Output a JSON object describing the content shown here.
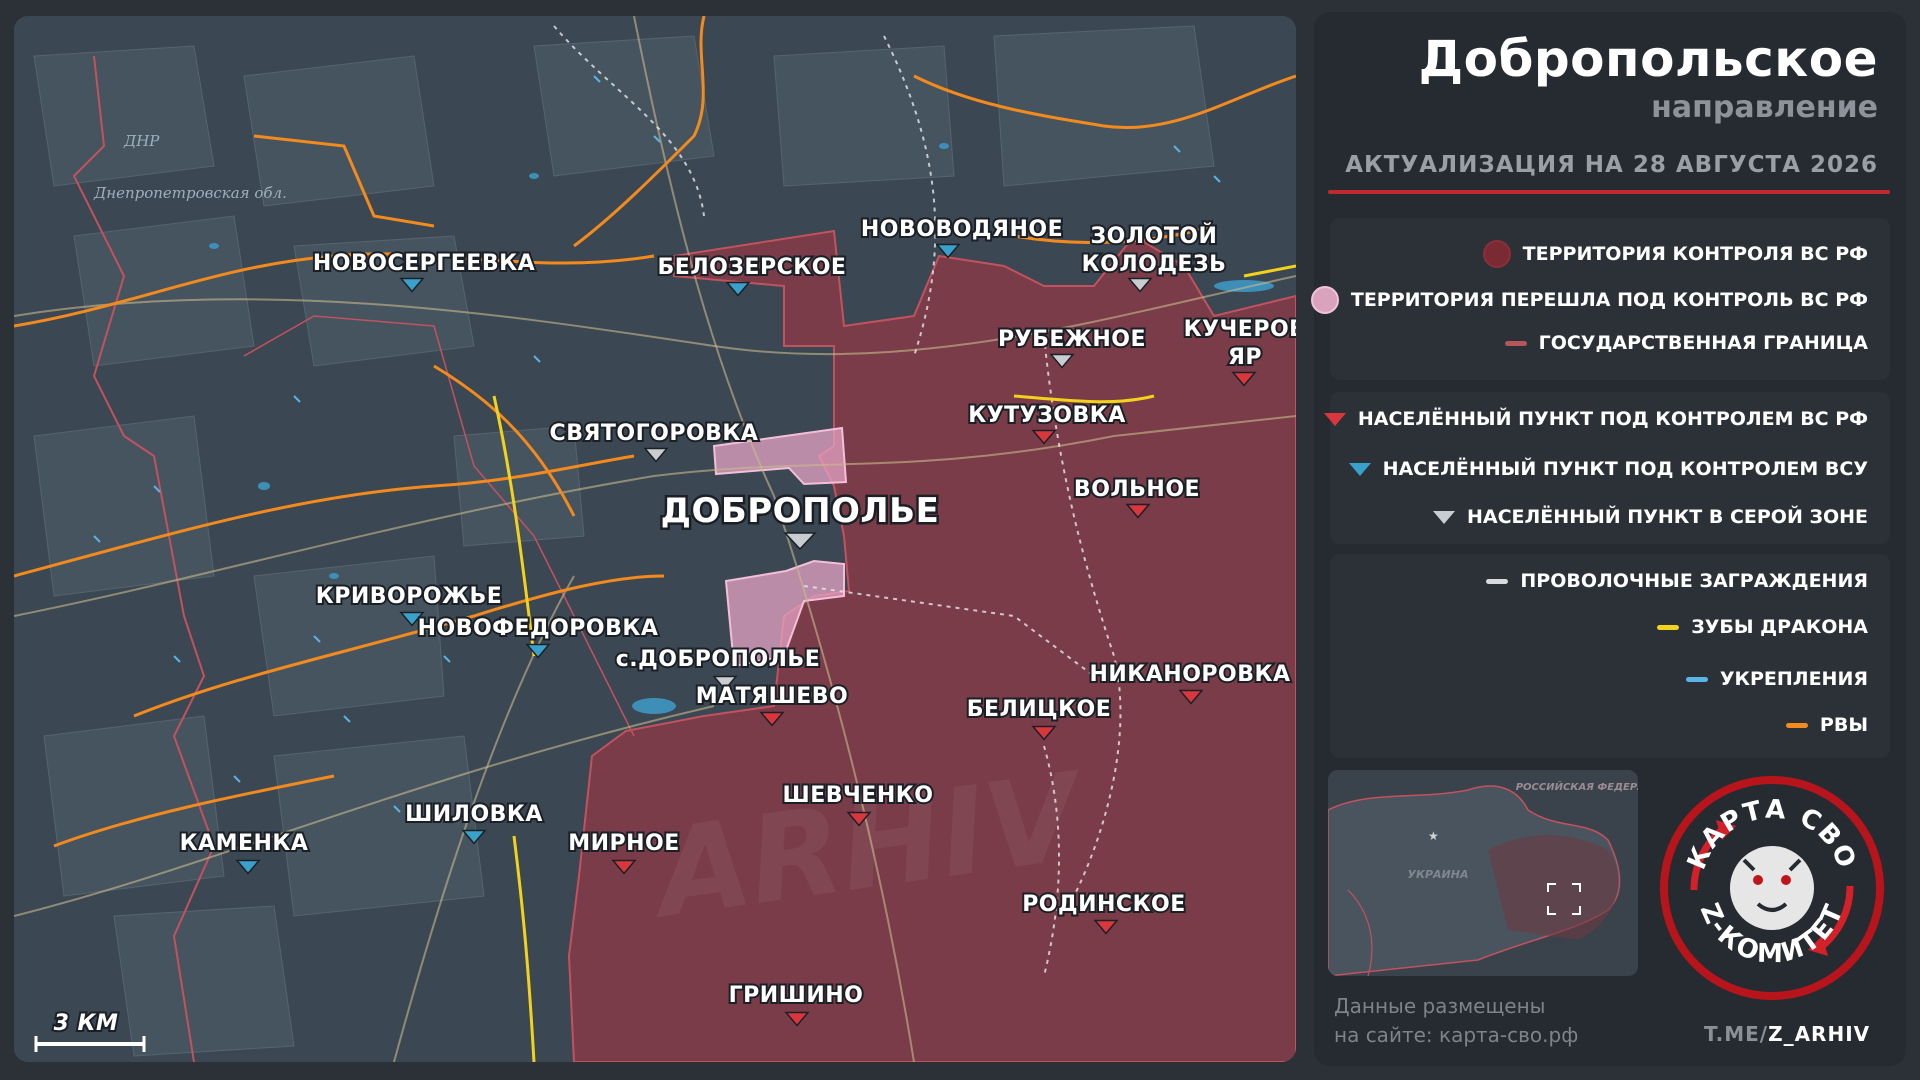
{
  "map": {
    "region_labels": {
      "dnr": "ДНР",
      "dnepr": "Днепропетровская обл."
    },
    "watermark": "ARHIV",
    "scale_label": "3 КМ",
    "settlements": [
      {
        "name": "НОВОСЕРГЕЕВКА",
        "status": "ua"
      },
      {
        "name": "БЕЛОЗЕРСКОЕ",
        "status": "ua"
      },
      {
        "name": "НОВОВОДЯНОЕ",
        "status": "ua"
      },
      {
        "name": "ЗОЛОТОЙ",
        "status": "gray"
      },
      {
        "name": "КОЛОДЕЗЬ",
        "status": "gray"
      },
      {
        "name": "РУБЕЖНОЕ",
        "status": "gray"
      },
      {
        "name": "КУЧЕРОВ",
        "status": "ru"
      },
      {
        "name": "ЯР",
        "status": "ru"
      },
      {
        "name": "КУТУЗОВКА",
        "status": "ru"
      },
      {
        "name": "СВЯТОГОРОВКА",
        "status": "gray"
      },
      {
        "name": "ДОБРОПОЛЬЕ",
        "status": "gray"
      },
      {
        "name": "ВОЛЬНОЕ",
        "status": "ru"
      },
      {
        "name": "КРИВОРОЖЬЕ",
        "status": "ua"
      },
      {
        "name": "НОВОФЕДОРОВКА",
        "status": "ua"
      },
      {
        "name": "с.ДОБРОПОЛЬЕ",
        "status": "gray"
      },
      {
        "name": "МАТЯШЕВО",
        "status": "ru"
      },
      {
        "name": "НИКАНОРОВКА",
        "status": "ru"
      },
      {
        "name": "БЕЛИЦКОЕ",
        "status": "ru"
      },
      {
        "name": "ШЕВЧЕНКО",
        "status": "ru"
      },
      {
        "name": "ШИЛОВКА",
        "status": "ua"
      },
      {
        "name": "КАМЕНКА",
        "status": "ua"
      },
      {
        "name": "МИРНОЕ",
        "status": "ru"
      },
      {
        "name": "РОДИНСКОЕ",
        "status": "ru"
      },
      {
        "name": "ГРИШИНО",
        "status": "ru"
      }
    ]
  },
  "header": {
    "title": "Добропольское",
    "subtitle": "направление",
    "update": "АКТУАЛИЗАЦИЯ НА 28 АВГУСТА 2026"
  },
  "legend": {
    "territory": [
      {
        "label": "ТЕРРИТОРИЯ КОНТРОЛЯ ВС РФ",
        "color": "#7a2a33"
      },
      {
        "label": "ТЕРРИТОРИЯ ПЕРЕШЛА ПОД КОНТРОЛЬ ВС РФ",
        "color": "#d9a3bd"
      },
      {
        "label": "ГОСУДАРСТВЕННАЯ ГРАНИЦА",
        "color": "#b5575a"
      }
    ],
    "settlements": [
      {
        "label": "НАСЕЛЁННЫЙ ПУНКТ ПОД КОНТРОЛЕМ ВС РФ",
        "color": "#d9363e"
      },
      {
        "label": "НАСЕЛЁННЫЙ ПУНКТ ПОД КОНТРОЛЕМ ВСУ",
        "color": "#3aa0cc"
      },
      {
        "label": "НАСЕЛЁННЫЙ ПУНКТ В СЕРОЙ ЗОНЕ",
        "color": "#c9cdd1"
      }
    ],
    "fortifications": [
      {
        "label": "ПРОВОЛОЧНЫЕ ЗАГРАЖДЕНИЯ",
        "color": "#d8dadc"
      },
      {
        "label": "ЗУБЫ ДРАКОНА",
        "color": "#f2d21b"
      },
      {
        "label": "УКРЕПЛЕНИЯ",
        "color": "#5ab4e6"
      },
      {
        "label": "РВЫ",
        "color": "#f28a1e"
      }
    ]
  },
  "mini_map": {
    "russia": "РОССИЙСКАЯ ФЕДЕРАЦИЯ",
    "ukraine": "УКРАИНА"
  },
  "source": {
    "line1": "Данные размещены",
    "line2": "на сайте: карта-сво.рф"
  },
  "telegram": {
    "prefix": "T.ME/",
    "channel": "Z_ARHIV"
  },
  "logo": {
    "top": "КАРТА СВО",
    "bottom": "Z-КОМИТЕТ"
  }
}
